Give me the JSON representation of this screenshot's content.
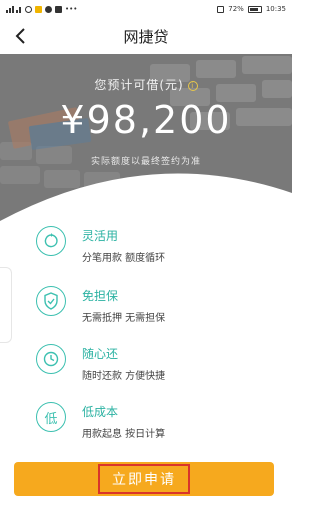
{
  "status_bar": {
    "battery": "72%",
    "time": "10:35"
  },
  "nav": {
    "title": "网捷贷",
    "back_icon": "chevron-left-icon"
  },
  "hero": {
    "subtitle": "您预计可借(元)",
    "amount": "¥98,200",
    "note": "实际额度以最终签约为准"
  },
  "features": [
    {
      "icon": "recycle-icon",
      "title": "灵活用",
      "desc": "分笔用款 额度循环"
    },
    {
      "icon": "shield-check-icon",
      "title": "免担保",
      "desc": "无需抵押 无需担保"
    },
    {
      "icon": "clock-icon",
      "title": "随心还",
      "desc": "随时还款 方便快捷"
    },
    {
      "icon": "low-badge-icon",
      "glyph": "低",
      "title": "低成本",
      "desc": "用款起息 按日计算"
    }
  ],
  "apply_button": {
    "label": "立即申请"
  },
  "colors": {
    "accent": "#2bb2a2",
    "button": "#f6a91e",
    "highlight_border": "#d9342b"
  }
}
